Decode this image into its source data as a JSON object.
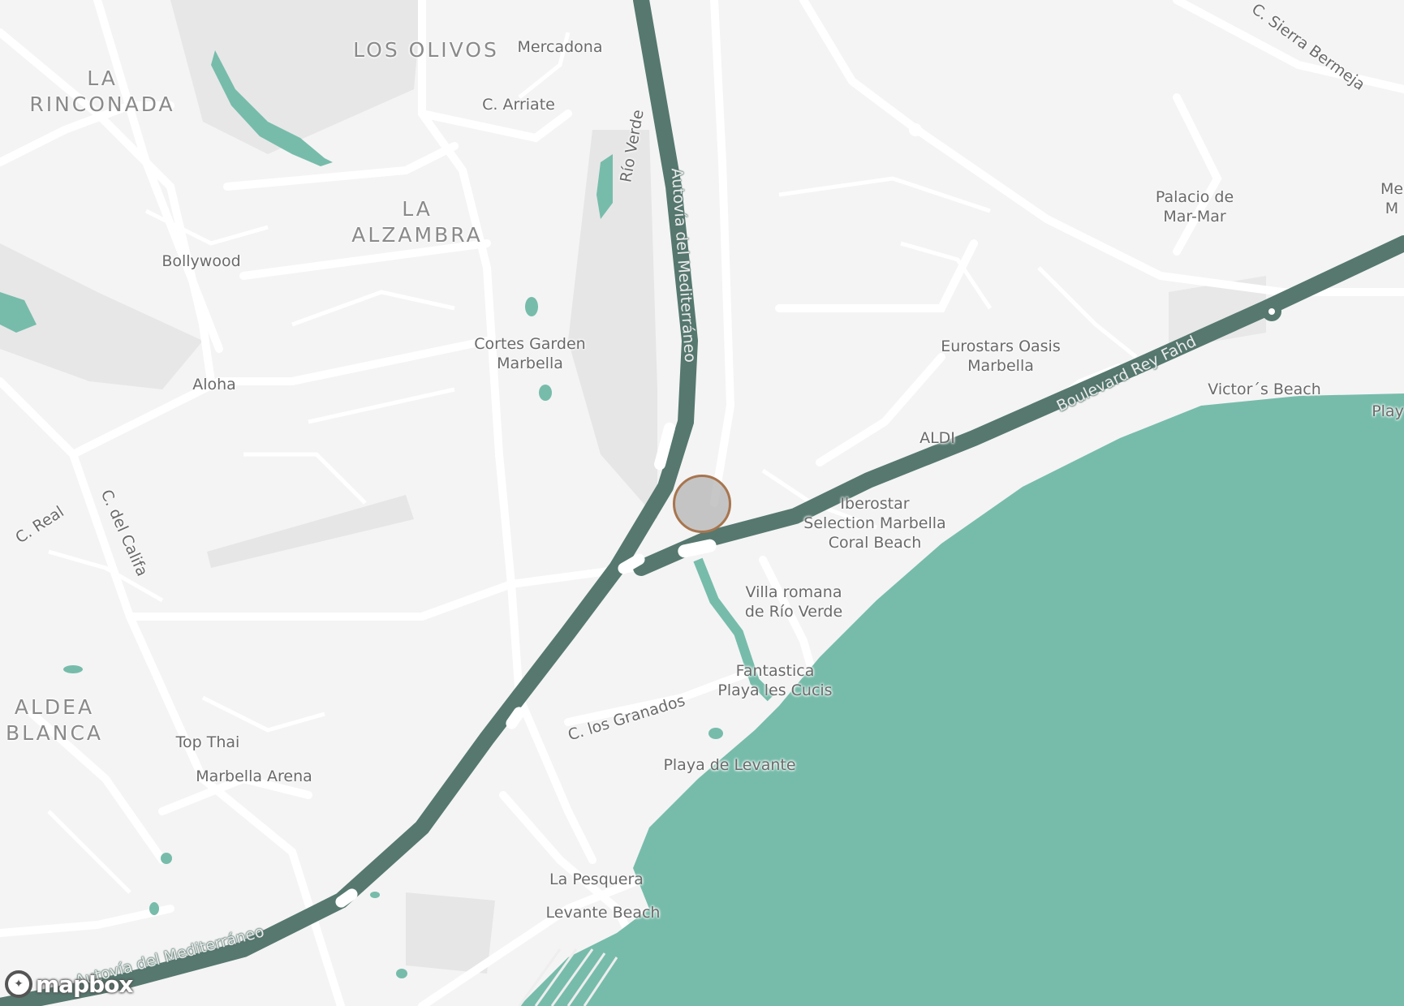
{
  "colors": {
    "land": "#f4f4f4",
    "road": "#ffffff",
    "park": "#e6e6e6",
    "water": "#77bcab",
    "highway": "#56786f",
    "marker_stroke": "#a8754e"
  },
  "neighborhoods": [
    "LOS OLIVOS",
    "LA\nRINCONADA",
    "LA\nALZAMBRA",
    "ALDEA\nBLANCA"
  ],
  "places": [
    "Mercadona",
    "Bollywood",
    "Aloha",
    "Cortes Garden\nMarbella",
    "Palacio de\nMar-Mar",
    "Eurostars Oasis\nMarbella",
    "ALDI",
    "Victor´s Beach",
    "Play",
    "Me\nM",
    "Iberostar\nSelection Marbella\nCoral Beach",
    "Villa romana\nde Río Verde",
    "Fantastica\nPlaya les Cucis",
    "Playa de Levante",
    "Top Thai",
    "Marbella Arena",
    "La Pesquera",
    "Levante Beach"
  ],
  "roads": [
    "C. Arriate",
    "Río Verde",
    "Autovía del Mediterráneo",
    "C. Sierra Bermeja",
    "Boulevard Rey Fahd",
    "C. Real",
    "C. del Califa",
    "C. los Granados",
    "Autovía del Mediterráneo"
  ],
  "attribution": {
    "logo_text": "mapbox",
    "icon": "mapbox-logo-icon"
  }
}
